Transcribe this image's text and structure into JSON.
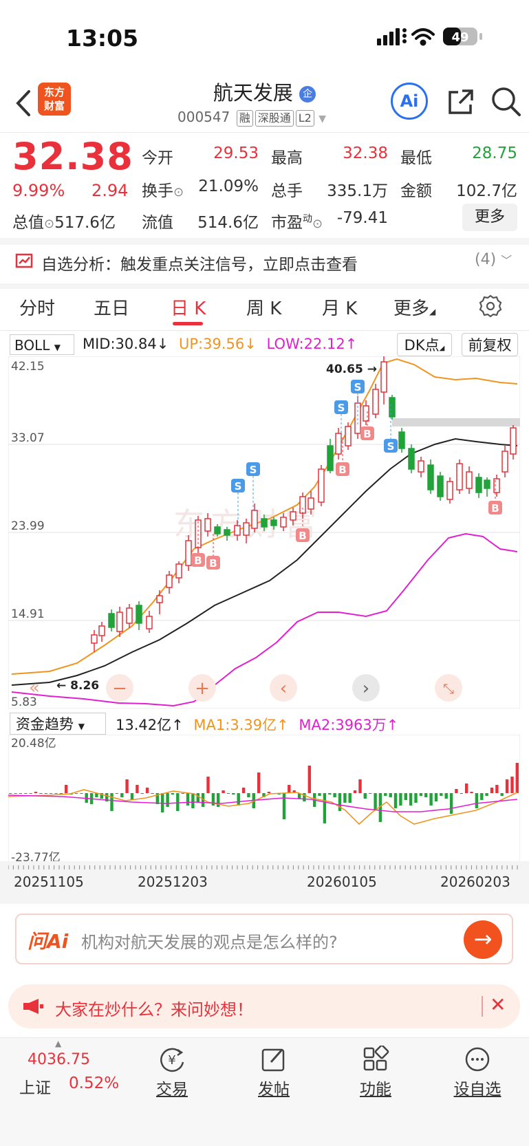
{
  "status": {
    "time": "13:05",
    "battery": "49"
  },
  "header": {
    "logo_line1": "东方",
    "logo_line2": "财富",
    "stock_name": "航天发展",
    "badge": "企",
    "code": "000547",
    "tags": [
      "融",
      "深股通",
      "L2"
    ],
    "ai_label": "Ai"
  },
  "quote": {
    "price": "32.38",
    "change_pct": "9.99%",
    "change_amt": "2.94",
    "open_label": "今开",
    "open": "29.53",
    "high_label": "最高",
    "high": "32.38",
    "low_label": "最低",
    "low": "28.75",
    "turnover_label": "换手",
    "turnover": "21.09%",
    "volume_label": "总手",
    "volume": "335.1万",
    "amount_label": "金额",
    "amount": "102.7亿",
    "total_cap_label": "总值",
    "total_cap": "517.6亿",
    "float_cap_label": "流值",
    "float_cap": "514.6亿",
    "pe_label": "市盈",
    "pe_sup": "动",
    "pe": "-79.41",
    "more_label": "更多"
  },
  "signal": {
    "text": "自选分析：触发重点关注信号，立即点击查看",
    "count": "(4)"
  },
  "tabs": [
    "分时",
    "五日",
    "日 K",
    "周 K",
    "月 K",
    "更多"
  ],
  "indicators": {
    "boll": "BOLL",
    "mid": "MID:30.84",
    "up": "UP:39.56",
    "low": "LOW:22.12",
    "dk": "DK点",
    "adjust": "前复权"
  },
  "colors": {
    "up": "#e8313a",
    "down": "#21a33a",
    "upper_band": "#f0941e",
    "lower_band": "#e020d0",
    "mid_band": "#222222"
  },
  "kchart": {
    "y_labels": [
      "42.15",
      "33.07",
      "23.99",
      "14.91",
      "5.83"
    ],
    "high_mark": "40.65",
    "low_mark": "8.26",
    "watermark": "东方财富",
    "markers_b": [
      "B",
      "B",
      "B",
      "B",
      "B",
      "B"
    ],
    "markers_s": [
      "S",
      "S",
      "S",
      "S",
      "S"
    ]
  },
  "fund": {
    "select": "资金趋势",
    "value": "13.42亿",
    "ma1": "MA1:3.39亿",
    "ma2": "MA2:3963万",
    "y_top": "20.48亿",
    "y_bottom": "-23.77亿"
  },
  "dates": [
    "20251105",
    "20251203",
    "20260105",
    "20260203"
  ],
  "ai_box": {
    "label": "问Ai",
    "placeholder": "机构对航天发展的观点是怎么样的?"
  },
  "banner": {
    "text": "大家在炒什么？来问妙想！"
  },
  "bottom": {
    "index_value": "4036.75",
    "index_name": "上证",
    "index_pct": "0.52%",
    "items": [
      "交易",
      "发帖",
      "功能",
      "设自选"
    ]
  }
}
